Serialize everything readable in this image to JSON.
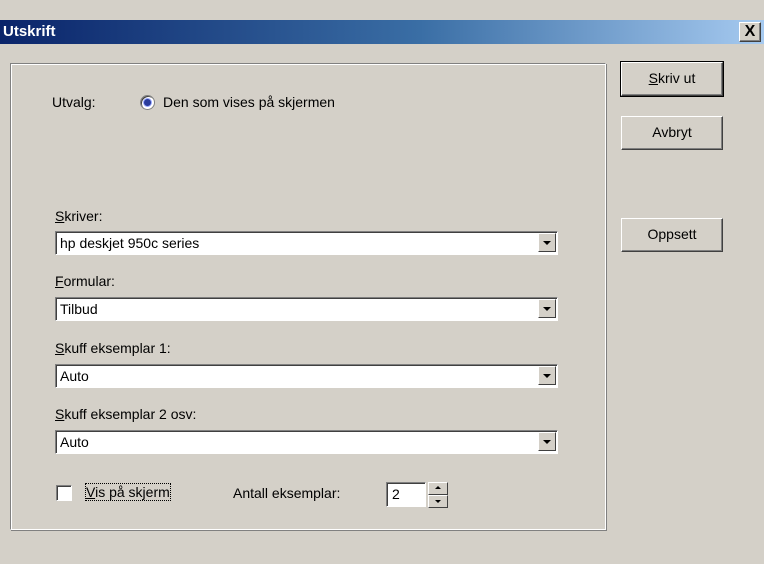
{
  "window": {
    "title": "Utskrift",
    "close_label": "X"
  },
  "selection": {
    "label": "Utvalg:",
    "radio_label": "Den som vises på skjermen"
  },
  "printer": {
    "label_mnemonic": "S",
    "label_rest": "kriver:",
    "value": "hp deskjet 950c series"
  },
  "form": {
    "label_mnemonic": "F",
    "label_rest": "ormular:",
    "value": "Tilbud"
  },
  "tray1": {
    "label_mnemonic": "S",
    "label_rest": "kuff eksemplar 1:",
    "value": "Auto"
  },
  "tray2": {
    "label_mnemonic": "S",
    "label_rest": "kuff eksemplar 2 osv:",
    "value": "Auto"
  },
  "show_on_screen": {
    "label_mnemonic": "V",
    "label_rest": "is på skjerm",
    "checked": false
  },
  "copies": {
    "label": "Antall eksemplar:",
    "value": "2"
  },
  "buttons": {
    "print_mnemonic": "S",
    "print_rest": "kriv ut",
    "cancel": "Avbryt",
    "setup": "Oppsett"
  }
}
